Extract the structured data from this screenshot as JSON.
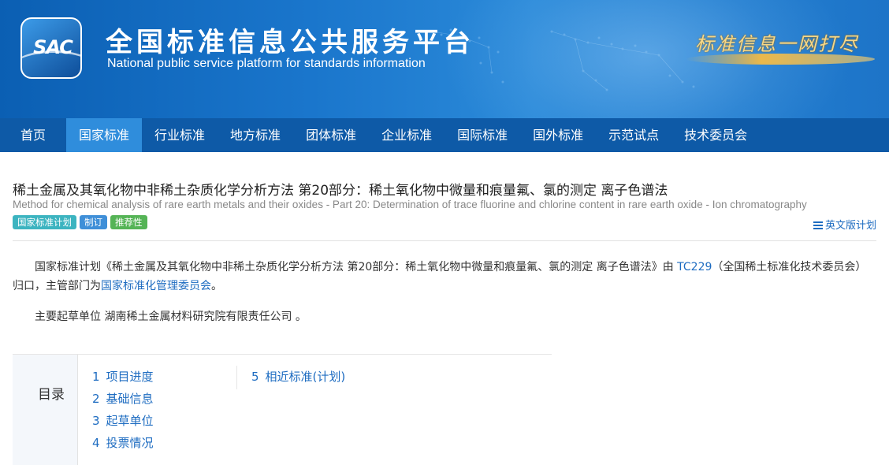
{
  "header": {
    "logo_text": "SAC",
    "title_cn": "全国标准信息公共服务平台",
    "title_en": "National public service platform  for standards information",
    "slogan": "标准信息一网打尽"
  },
  "nav": {
    "items": [
      "首页",
      "国家标准",
      "行业标准",
      "地方标准",
      "团体标准",
      "企业标准",
      "国际标准",
      "国外标准",
      "示范试点",
      "技术委员会"
    ],
    "active": "国家标准"
  },
  "standard": {
    "title": "稀土金属及其氧化物中非稀土杂质化学分析方法 第20部分：稀土氧化物中微量和痕量氟、氯的测定 离子色谱法",
    "title_en": "Method for chemical analysis of rare earth metals and their oxides -  Part 20: Determination of trace fluorine and chlorine content in rare earth oxide  -  Ion chromatography",
    "tags": [
      "国家标准计划",
      "制订",
      "推荐性"
    ],
    "en_plan_label": "英文版计划"
  },
  "description": {
    "p1_prefix": "国家标准计划《稀土金属及其氧化物中非稀土杂质化学分析方法 第20部分：稀土氧化物中微量和痕量氟、氯的测定 离子色谱法》由 ",
    "tc_link": "TC229",
    "p1_mid": "（全国稀土标准化技术委员会）归口，主管部门为",
    "authority_link": "国家标准化管理委员会",
    "p1_end": "。",
    "p2": "主要起草单位 湖南稀土金属材料研究院有限责任公司 。"
  },
  "toc": {
    "label": "目录",
    "col1": [
      {
        "num": "1",
        "label": "项目进度"
      },
      {
        "num": "2",
        "label": "基础信息"
      },
      {
        "num": "3",
        "label": "起草单位"
      },
      {
        "num": "4",
        "label": "投票情况"
      }
    ],
    "col2": [
      {
        "num": "5",
        "label": "相近标准(计划)"
      }
    ]
  },
  "colors": {
    "nav_bg": "#0e5aa7",
    "nav_active": "#2f8ddc",
    "link": "#1e6cc1",
    "tag_plan": "#3cb4c0",
    "tag_make": "#3f8fd8",
    "tag_recommend": "#55b456"
  }
}
